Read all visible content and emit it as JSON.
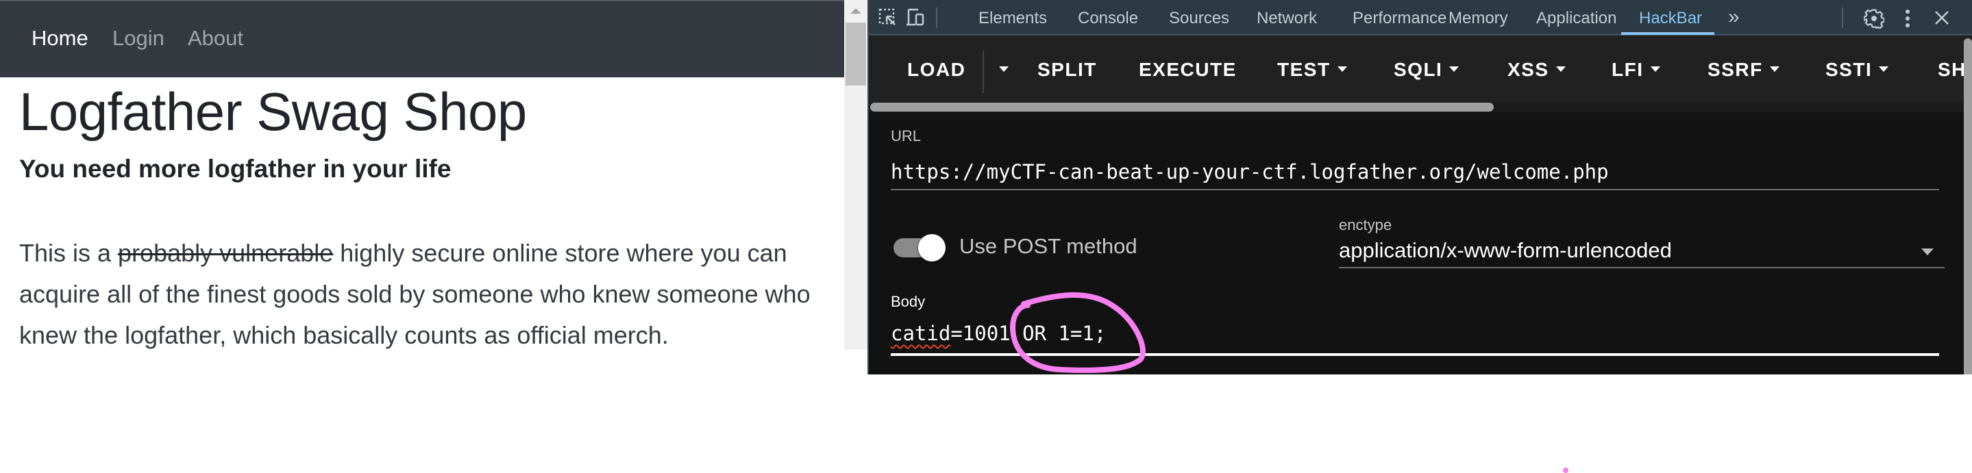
{
  "page": {
    "nav": [
      {
        "label": "Home",
        "active": true
      },
      {
        "label": "Login",
        "active": false
      },
      {
        "label": "About",
        "active": false
      }
    ],
    "title": "Logfather Swag Shop",
    "subtitle": "You need more logfather in your life",
    "lead": {
      "before": "This is a ",
      "struck": "probably vulnerable",
      "after": " highly secure online store where you can acquire all of the finest goods sold by someone who knew someone who knew the logfather, which basically counts as official merch."
    }
  },
  "devtools": {
    "icons": [
      "inspect-element-icon",
      "device-toolbar-icon"
    ],
    "tabs": [
      "Elements",
      "Console",
      "Sources",
      "Network",
      "Performance",
      "Memory",
      "Application",
      "HackBar"
    ],
    "active_tab": "HackBar",
    "more_tabs_label": "»",
    "right_icons": [
      "gear-icon",
      "more-vert-icon",
      "close-icon"
    ],
    "accent_color": "#8ac6f2"
  },
  "hackbar": {
    "toolbar": [
      {
        "label": "LOAD",
        "dropdown": false
      },
      {
        "label": "SPLIT",
        "dropdown": false
      },
      {
        "label": "EXECUTE",
        "dropdown": false
      },
      {
        "label": "TEST",
        "dropdown": true
      },
      {
        "label": "SQLI",
        "dropdown": true
      },
      {
        "label": "XSS",
        "dropdown": true
      },
      {
        "label": "LFI",
        "dropdown": true
      },
      {
        "label": "SSRF",
        "dropdown": true
      },
      {
        "label": "SSTI",
        "dropdown": true
      },
      {
        "label": "SH",
        "dropdown": false
      }
    ],
    "url_label": "URL",
    "url_value": "https://myCTF-can-beat-up-your-ctf.logfather.org/welcome.php",
    "post_toggle_label": "Use POST method",
    "post_enabled": true,
    "enctype_label": "enctype",
    "enctype_value": "application/x-www-form-urlencoded",
    "body_label": "Body",
    "body_value": {
      "spellchecked": "catid",
      "rest": "=1001 OR 1=1;"
    }
  },
  "annotation": {
    "type": "hand-drawn circle",
    "encircles": "1 OR 1=1;",
    "color": "#f77ff0"
  }
}
